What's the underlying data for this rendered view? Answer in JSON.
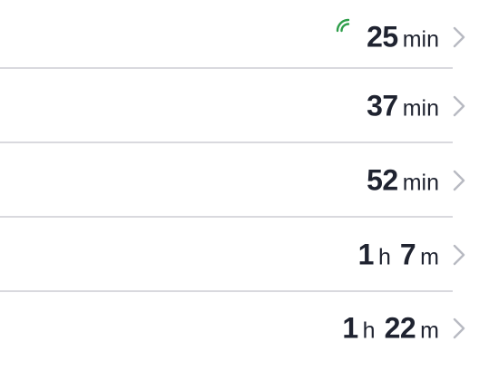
{
  "rows": [
    {
      "parts": [
        {
          "num": "25",
          "unit": "min"
        }
      ],
      "live": true
    },
    {
      "parts": [
        {
          "num": "37",
          "unit": "min"
        }
      ],
      "live": false
    },
    {
      "parts": [
        {
          "num": "52",
          "unit": "min"
        }
      ],
      "live": false
    },
    {
      "parts": [
        {
          "num": "1",
          "unit": "h"
        },
        {
          "num": "7",
          "unit": "m"
        }
      ],
      "live": false
    },
    {
      "parts": [
        {
          "num": "1",
          "unit": "h"
        },
        {
          "num": "22",
          "unit": "m"
        }
      ],
      "live": false
    }
  ],
  "colors": {
    "text": "#1f2330",
    "live": "#2e9e4a",
    "chevron": "#b8bac2",
    "divider": "#d9d9de"
  },
  "icons": {
    "live": "live-tracking-icon",
    "chevron": "chevron-right-icon"
  }
}
